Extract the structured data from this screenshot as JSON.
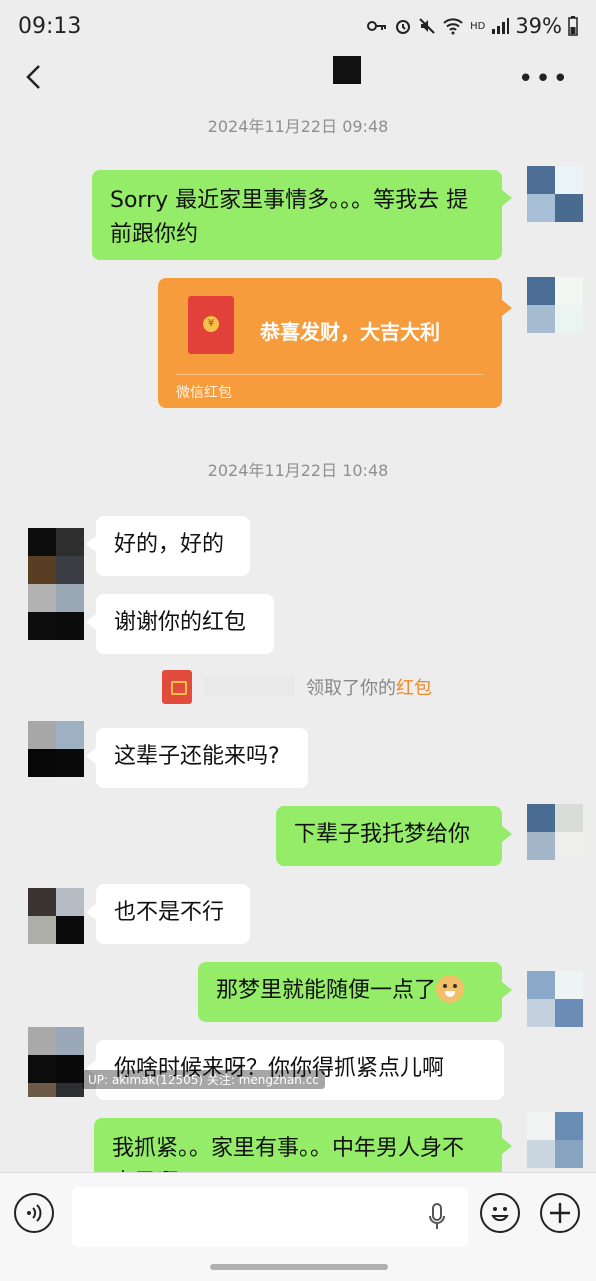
{
  "status_bar": {
    "time": "09:13",
    "battery": "39%",
    "hd": "HD"
  },
  "nav": {
    "back_label": "‹",
    "more_label": "•••"
  },
  "messages": {
    "stamp1": "2024年11月22日 09:48",
    "m1": "Sorry 最近家里事情多。。。等我去    提前跟你约",
    "red_packet": {
      "title": "恭喜发财，大吉大利",
      "source": "微信红包"
    },
    "stamp2": "2024年11月22日 10:48",
    "m2": "好的，好的",
    "m3": "谢谢你的红包",
    "system": {
      "text": "领取了你的",
      "link": "红包"
    },
    "m4": "这辈子还能来吗?",
    "m5": "下辈子我托梦给你",
    "m6": "也不是不行",
    "m7": "那梦里就能随便一点了",
    "m8": "你啥时候来呀？你你得抓紧点儿啊",
    "m9": "我抓紧。。家里有事。。中年男人身不由己啊"
  },
  "watermark": "UP: akimak(12505) 关注: mengzhan.cc",
  "colors": {
    "me_bubble": "#95ec69",
    "them_bubble": "#ffffff",
    "red_packet": "#f79c3d",
    "background": "#ededed"
  },
  "icons": {
    "voice": "voice-icon",
    "mic": "mic-icon",
    "emoji": "emoji-icon",
    "plus": "plus-icon"
  }
}
